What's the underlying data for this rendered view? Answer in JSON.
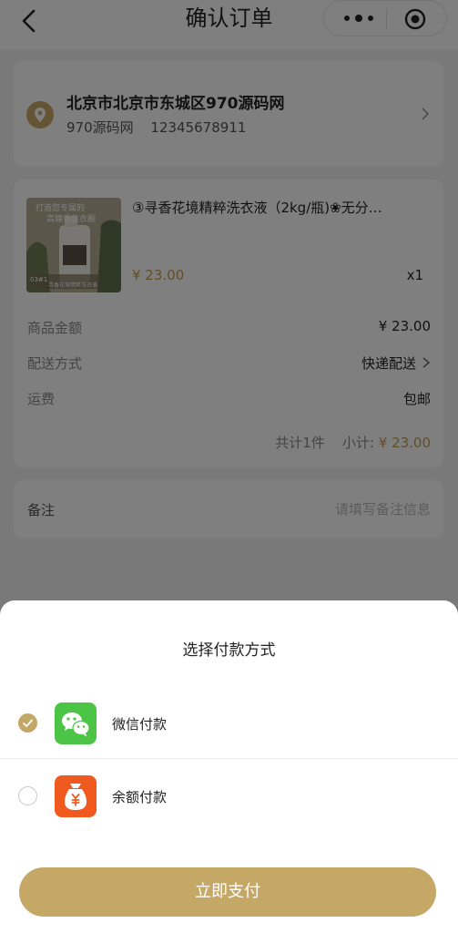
{
  "navbar": {
    "title": "确认订单"
  },
  "address": {
    "full_address": "北京市北京市东城区970源码网",
    "name": "970源码网",
    "phone": "12345678911"
  },
  "product": {
    "name": "③寻香花境精粹洗衣液（2kg/瓶)❀无分…",
    "price": "¥ 23.00",
    "quantity": "x1",
    "image_text": {
      "line1": "打造您专属的",
      "line2": "高端香氛衣橱",
      "badge": "03#1",
      "caption": "寻香花境精粹洗衣液"
    }
  },
  "order_rows": [
    {
      "label": "商品金额",
      "value": "¥ 23.00"
    },
    {
      "label": "配送方式",
      "value": "快递配送"
    },
    {
      "label": "运费",
      "value": "包邮"
    }
  ],
  "summary": {
    "count_text": "共计1件",
    "subtotal_label": "小计:",
    "subtotal_value": "¥ 23.00"
  },
  "remark": {
    "label": "备注",
    "placeholder": "请填写备注信息",
    "value": ""
  },
  "payment_sheet": {
    "title": "选择付款方式",
    "methods": [
      {
        "label": "微信付款",
        "icon": "wechat-icon",
        "selected": true
      },
      {
        "label": "余额付款",
        "icon": "balance-wallet-icon",
        "selected": false
      }
    ],
    "pay_button_label": "立即支付"
  },
  "colors": {
    "accent_gold": "#c6a866",
    "price_gold": "#c29c52",
    "wechat_green": "#4cc445",
    "balance_orange": "#f05a1e"
  }
}
